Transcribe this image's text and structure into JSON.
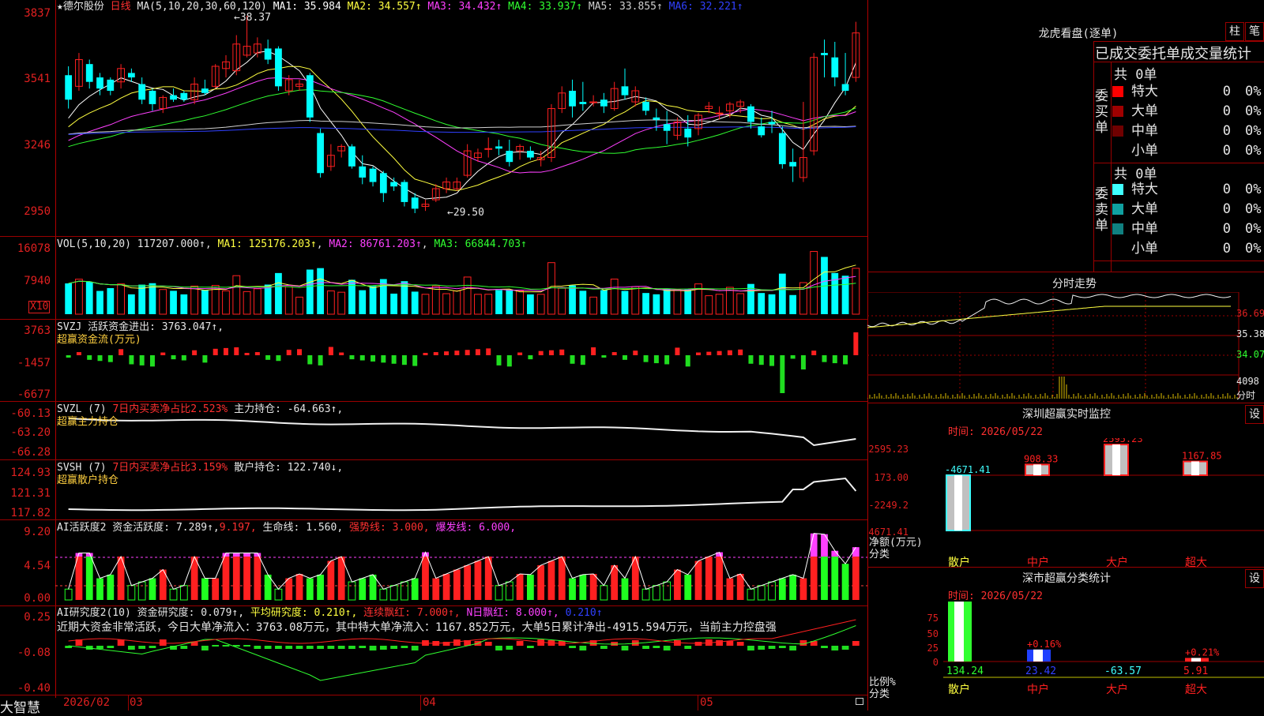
{
  "stock": {
    "star": "★",
    "name": "德尔股份",
    "period": "日线",
    "ma_params": "MA(5,10,20,30,60,120)"
  },
  "main": {
    "ma": [
      {
        "label": "MA1:",
        "value": "35.984",
        "color": "#ffffff"
      },
      {
        "label": "MA2:",
        "value": "34.557↑",
        "color": "#ffff40"
      },
      {
        "label": "MA3:",
        "value": "34.432↑",
        "color": "#ff40ff"
      },
      {
        "label": "MA4:",
        "value": "33.937↑",
        "color": "#30ff30"
      },
      {
        "label": "MA5:",
        "value": "33.855↑",
        "color": "#d0d0d0"
      },
      {
        "label": "MA6:",
        "value": "32.221↑",
        "color": "#3040ff"
      }
    ],
    "yticks": [
      "3837",
      "3541",
      "3246",
      "2950"
    ],
    "high_label": "38.37",
    "low_label": "29.50",
    "ylim": [
      29.5,
      38.37
    ]
  },
  "vol": {
    "legend": "VOL(5,10,20)",
    "value": "117207.000↑",
    "ma1": "MA1: 125176.203↑",
    "ma2": "MA2: 86761.203↑",
    "ma3": "MA3: 66844.703↑",
    "yticks": [
      "16078",
      "7940"
    ],
    "unit": "X10"
  },
  "svzj": {
    "legend": "SVZJ  活跃资金进出: 3763.047↑,",
    "subtitle": "超赢资金流(万元)",
    "yticks": [
      "3763",
      "-1457",
      "-6677"
    ]
  },
  "svzl": {
    "legend_a": "SVZL (7)",
    "legend_b": "7日内买卖净占比2.523%",
    "legend_c": "主力持仓: -64.663↑,",
    "subtitle": "超赢主力持仓",
    "yticks": [
      "-60.13",
      "-63.20",
      "-66.28"
    ]
  },
  "svsh": {
    "legend_a": "SVSH (7)",
    "legend_b": "7日内买卖净占比3.159%",
    "legend_c": "散户持仓: 122.740↓,",
    "subtitle": "超赢散户持仓",
    "yticks": [
      "124.93",
      "121.31",
      "117.82"
    ]
  },
  "ai1": {
    "legend_a": "AI活跃度2 资金活跃度: 7.289↑,",
    "legend_b": "9.197,",
    "legend_c": "生命线: 1.560,",
    "legend_d": "强势线: 3.000,",
    "legend_e": "爆发线: 6.000,",
    "yticks": [
      "9.20",
      "4.54",
      "0.00"
    ]
  },
  "ai2": {
    "legend_a": "AI研究度2(10) 资金研究度: 0.079↑,",
    "legend_b": "平均研究度: 0.210↑,",
    "legend_c": "连续飘红: 7.000↑,",
    "legend_d": "N日飘红: 8.000↑,",
    "legend_e": "0.210↑",
    "comment": "近期大资金非常活跃，今日大单净流入：3763.08万元，其中特大单净流入：1167.852万元，大单5日累计净出-4915.594万元，当前主力控盘强",
    "yticks": [
      "0.25",
      "-0.08",
      "-0.40"
    ]
  },
  "xaxis": {
    "labels": [
      "2026/02",
      "03",
      "04",
      "05"
    ]
  },
  "footer": {
    "brand": "大智慧"
  },
  "longhu": {
    "title": "龙虎看盘(逐单)",
    "btn_bar": "柱",
    "btn_pen": "笔",
    "header": "已成交委托单成交量统计",
    "buy_title": "委买单",
    "sell_title": "委卖单",
    "buy_total": "共 0单",
    "sell_total": "共 0单",
    "buy_rows": [
      {
        "name": "特大",
        "value": "0",
        "pct": "0%",
        "color": "#ff0000"
      },
      {
        "name": "大单",
        "value": "0",
        "pct": "0%",
        "color": "#a00000"
      },
      {
        "name": "中单",
        "value": "0",
        "pct": "0%",
        "color": "#700000"
      },
      {
        "name": "小单",
        "value": "0",
        "pct": "0%",
        "color": "#000000"
      }
    ],
    "sell_rows": [
      {
        "name": "特大",
        "value": "0",
        "pct": "0%",
        "color": "#40ffff"
      },
      {
        "name": "大单",
        "value": "0",
        "pct": "0%",
        "color": "#10a0a0"
      },
      {
        "name": "中单",
        "value": "0",
        "pct": "0%",
        "color": "#108080"
      },
      {
        "name": "小单",
        "value": "0",
        "pct": "0%",
        "color": "#000000"
      }
    ]
  },
  "intraday": {
    "title": "分时走势",
    "yticks": [
      "36.69",
      "35.38",
      "34.07"
    ],
    "vol_label": "4098",
    "vol_unit": "分时"
  },
  "monitor": {
    "title": "深圳超赢实时监控",
    "btn": "设",
    "time": "时间: 2026/05/22",
    "yticks": [
      "2595.23",
      "173.00",
      "-2249.2",
      "-4671.41"
    ],
    "ylabel_a": "净额(万元)",
    "ylabel_b": "分类",
    "categories": [
      "散户",
      "中户",
      "大户",
      "超大"
    ],
    "values": [
      -4671.41,
      908.33,
      2595.23,
      1167.85
    ],
    "value_labels": [
      "-4671.41",
      "908.33",
      "2595.23",
      "1167.85"
    ]
  },
  "classify": {
    "title": "深市超赢分类统计",
    "btn": "设",
    "time": "时间: 2026/05/22",
    "yticks": [
      "75",
      "50",
      "25",
      "0"
    ],
    "ylabel_a": "比例%",
    "ylabel_b": "分类",
    "categories": [
      "散户",
      "中户",
      "大户",
      "超大"
    ],
    "top_labels": [
      "",
      "+0.16%",
      "",
      "+0.21%"
    ],
    "bottom_labels": [
      "134.24",
      "23.42",
      "-63.57",
      "5.91"
    ],
    "bar_pct": [
      100,
      20,
      0,
      6
    ]
  }
}
